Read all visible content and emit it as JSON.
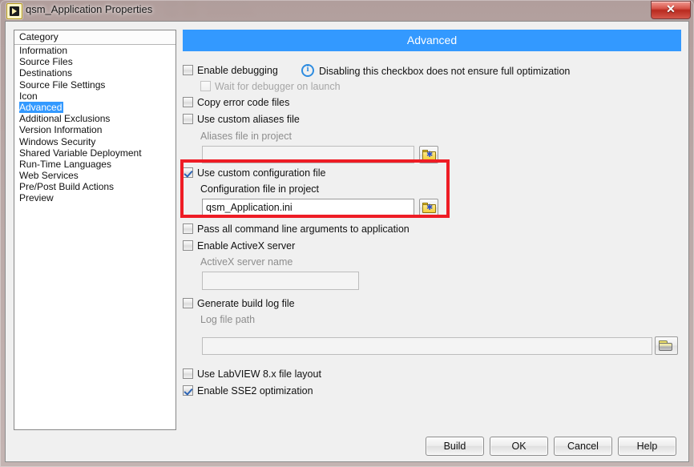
{
  "window": {
    "title": "qsm_Application Properties",
    "icon": "labview-vi-icon",
    "close_label": "✕"
  },
  "sidebar": {
    "header": "Category",
    "items": [
      {
        "label": "Information",
        "selected": false
      },
      {
        "label": "Source Files",
        "selected": false
      },
      {
        "label": "Destinations",
        "selected": false
      },
      {
        "label": "Source File Settings",
        "selected": false
      },
      {
        "label": "Icon",
        "selected": false
      },
      {
        "label": "Advanced",
        "selected": true
      },
      {
        "label": "Additional Exclusions",
        "selected": false
      },
      {
        "label": "Version Information",
        "selected": false
      },
      {
        "label": "Windows Security",
        "selected": false
      },
      {
        "label": "Shared Variable Deployment",
        "selected": false
      },
      {
        "label": "Run-Time Languages",
        "selected": false
      },
      {
        "label": "Web Services",
        "selected": false
      },
      {
        "label": "Pre/Post Build Actions",
        "selected": false
      },
      {
        "label": "Preview",
        "selected": false
      }
    ]
  },
  "panel": {
    "header": "Advanced",
    "enable_debugging": {
      "label": "Enable debugging",
      "checked": false
    },
    "debug_note": {
      "text": "Disabling this checkbox does not ensure full optimization",
      "icon": "info-icon"
    },
    "wait_for_debugger": {
      "label": "Wait for debugger on launch",
      "checked": false,
      "disabled": true
    },
    "copy_error_code_files": {
      "label": "Copy error code files",
      "checked": false
    },
    "use_custom_aliases": {
      "label": "Use custom aliases file",
      "checked": false
    },
    "aliases_file": {
      "label": "Aliases file in project",
      "value": "",
      "disabled": true,
      "browse_icon": "folder-star-icon"
    },
    "use_custom_config": {
      "label": "Use custom configuration file",
      "checked": true
    },
    "config_file": {
      "label": "Configuration file in project",
      "value": "qsm_Application.ini",
      "browse_icon": "folder-star-icon"
    },
    "pass_all_args": {
      "label": "Pass all command line arguments to application",
      "checked": false
    },
    "enable_activex": {
      "label": "Enable ActiveX server",
      "checked": false
    },
    "activex_name": {
      "label": "ActiveX server name",
      "value": "",
      "disabled": true
    },
    "generate_build_log": {
      "label": "Generate build log file",
      "checked": false
    },
    "log_file_path": {
      "label": "Log file path",
      "value": "",
      "disabled": true,
      "browse_icon": "folder-open-icon"
    },
    "use_labview8_layout": {
      "label": "Use LabVIEW 8.x file layout",
      "checked": false
    },
    "enable_sse2": {
      "label": "Enable SSE2 optimization",
      "checked": true
    }
  },
  "annotation": {
    "color": "#ee1c25",
    "target": "use-custom-configuration-file-group"
  },
  "footer": {
    "build": "Build",
    "ok": "OK",
    "cancel": "Cancel",
    "help": "Help"
  },
  "colors": {
    "accent": "#3399ff",
    "highlight": "#ee1c25",
    "frame": "#b9a6a4"
  }
}
